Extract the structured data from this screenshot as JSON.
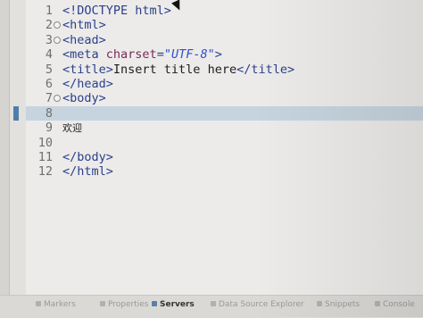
{
  "editor": {
    "lines": [
      {
        "n": "1",
        "parts": [
          {
            "t": "<!DOCTYPE html>",
            "c": "tag"
          }
        ]
      },
      {
        "n": "2",
        "fold": true,
        "parts": [
          {
            "t": "<html>",
            "c": "tag"
          }
        ]
      },
      {
        "n": "3",
        "fold": true,
        "parts": [
          {
            "t": "<head>",
            "c": "tag"
          }
        ]
      },
      {
        "n": "4",
        "parts": [
          {
            "t": "<meta ",
            "c": "tag"
          },
          {
            "t": "charset",
            "c": "attr"
          },
          {
            "t": "=",
            "c": "tag"
          },
          {
            "t": "\"UTF-8\"",
            "c": "str"
          },
          {
            "t": ">",
            "c": "tag"
          }
        ]
      },
      {
        "n": "5",
        "parts": [
          {
            "t": "<title>",
            "c": "tag"
          },
          {
            "t": "Insert title here",
            "c": ""
          },
          {
            "t": "</title>",
            "c": "tag"
          }
        ]
      },
      {
        "n": "6",
        "parts": [
          {
            "t": "</head>",
            "c": "tag"
          }
        ]
      },
      {
        "n": "7",
        "fold": true,
        "parts": [
          {
            "t": "<body>",
            "c": "tag"
          }
        ]
      },
      {
        "n": "8",
        "current": true,
        "parts": []
      },
      {
        "n": "9",
        "parts": [
          {
            "t": "欢迎",
            "c": "cjk"
          }
        ]
      },
      {
        "n": "10",
        "parts": []
      },
      {
        "n": "11",
        "parts": [
          {
            "t": "</body>",
            "c": "tag"
          }
        ]
      },
      {
        "n": "12",
        "parts": [
          {
            "t": "</html>",
            "c": "tag"
          }
        ]
      }
    ]
  },
  "bottom_tabs": [
    {
      "label": "Markers",
      "active": false
    },
    {
      "label": "Properties",
      "active": false
    },
    {
      "label": "Servers",
      "active": true
    },
    {
      "label": "Data Source Explorer",
      "active": false
    },
    {
      "label": "Snippets",
      "active": false
    },
    {
      "label": "Console",
      "active": false
    }
  ]
}
